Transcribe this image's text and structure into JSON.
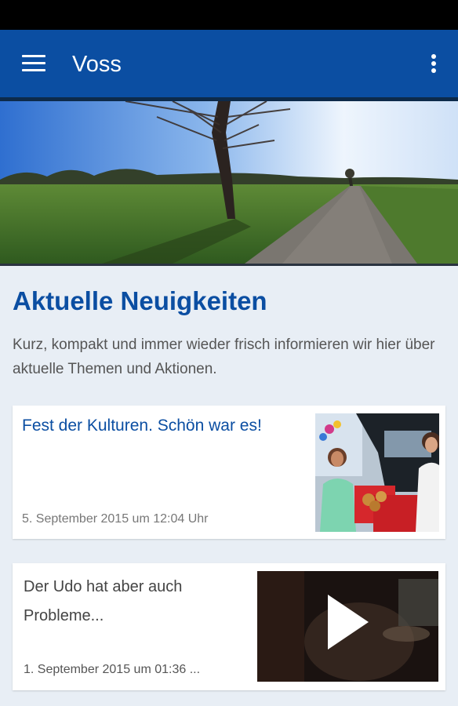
{
  "app_bar": {
    "title": "Voss",
    "menu_icon": "hamburger-menu-icon",
    "overflow_icon": "more-vertical-icon",
    "color": "#0b4ea2"
  },
  "hero": {
    "description_icon": "landscape-photo"
  },
  "news_section": {
    "title": "Aktuelle Neuigkeiten",
    "description": "Kurz, kompakt und immer wieder frisch informieren wir hier über aktuelle Themen und Aktionen."
  },
  "articles": [
    {
      "title": "Fest der Kulturen. Schön war es!",
      "date": "5. September 2015 um 12:04 Uhr",
      "thumbnail": "festival-photo"
    },
    {
      "title": "Der Udo hat aber auch Probleme...",
      "date": "1. September 2015 um 01:36 ...",
      "thumbnail": "video-thumbnail",
      "has_video": true
    }
  ],
  "colors": {
    "accent": "#0b4ea2",
    "background": "#e8eef5"
  }
}
